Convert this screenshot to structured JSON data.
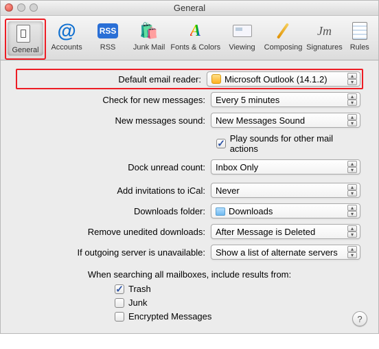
{
  "title": "General",
  "toolbar": [
    {
      "label": "General",
      "name": "tab-general",
      "selected": true
    },
    {
      "label": "Accounts",
      "name": "tab-accounts",
      "selected": false
    },
    {
      "label": "RSS",
      "name": "tab-rss",
      "selected": false
    },
    {
      "label": "Junk Mail",
      "name": "tab-junk-mail",
      "selected": false
    },
    {
      "label": "Fonts & Colors",
      "name": "tab-fonts-colors",
      "selected": false
    },
    {
      "label": "Viewing",
      "name": "tab-viewing",
      "selected": false
    },
    {
      "label": "Composing",
      "name": "tab-composing",
      "selected": false
    },
    {
      "label": "Signatures",
      "name": "tab-signatures",
      "selected": false
    },
    {
      "label": "Rules",
      "name": "tab-rules",
      "selected": false
    }
  ],
  "fields": {
    "default_reader": {
      "label": "Default email reader:",
      "value": "Microsoft Outlook (14.1.2)"
    },
    "check_messages": {
      "label": "Check for new messages:",
      "value": "Every 5 minutes"
    },
    "new_sound": {
      "label": "New messages sound:",
      "value": "New Messages Sound"
    },
    "play_sounds": {
      "label": "Play sounds for other mail actions",
      "checked": true
    },
    "dock_unread": {
      "label": "Dock unread count:",
      "value": "Inbox Only"
    },
    "invitations": {
      "label": "Add invitations to iCal:",
      "value": "Never"
    },
    "downloads": {
      "label": "Downloads folder:",
      "value": "Downloads"
    },
    "remove_unedited": {
      "label": "Remove unedited downloads:",
      "value": "After Message is Deleted"
    },
    "outgoing_unavail": {
      "label": "If outgoing server is unavailable:",
      "value": "Show a list of alternate servers"
    }
  },
  "search": {
    "heading": "When searching all mailboxes, include results from:",
    "items": [
      {
        "label": "Trash",
        "checked": true
      },
      {
        "label": "Junk",
        "checked": false
      },
      {
        "label": "Encrypted Messages",
        "checked": false
      }
    ]
  }
}
